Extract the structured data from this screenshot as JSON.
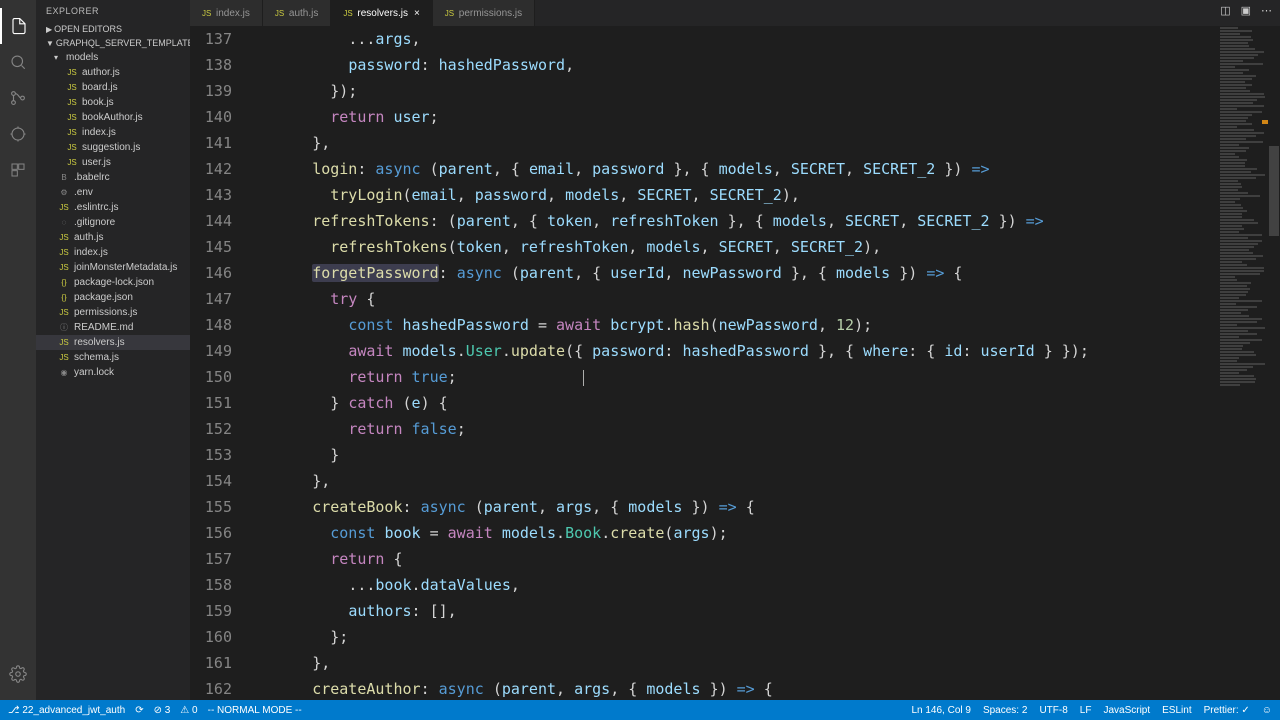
{
  "explorer": {
    "title": "EXPLORER"
  },
  "sections": {
    "openEditors": "OPEN EDITORS",
    "project": "GRAPHQL_SERVER_TEMPLATE"
  },
  "tree": {
    "folder_models": "models",
    "files_models": [
      "author.js",
      "board.js",
      "book.js",
      "bookAuthor.js",
      "index.js",
      "suggestion.js",
      "user.js"
    ],
    "files_root": [
      ".babelrc",
      ".env",
      ".eslintrc.js",
      ".gitignore",
      "auth.js",
      "index.js",
      "joinMonsterMetadata.js",
      "package-lock.json",
      "package.json",
      "permissions.js",
      "README.md",
      "resolvers.js",
      "schema.js",
      "yarn.lock"
    ]
  },
  "tabs": [
    {
      "label": "index.js",
      "active": false
    },
    {
      "label": "auth.js",
      "active": false
    },
    {
      "label": "resolvers.js",
      "active": true
    },
    {
      "label": "permissions.js",
      "active": false
    }
  ],
  "lineStart": 137,
  "lineCount": 26,
  "code": [
    {
      "i": 0,
      "h": "          <span class='tk-p'>...</span><span class='tk-v'>args</span><span class='tk-p'>,</span>"
    },
    {
      "i": 0,
      "h": "          <span class='tk-v'>password</span><span class='tk-p'>:</span> <span class='tk-v'>hashedPassword</span><span class='tk-p'>,</span>"
    },
    {
      "i": 0,
      "h": "        <span class='tk-p'>});</span>"
    },
    {
      "i": 0,
      "h": "        <span class='tk-k'>return</span> <span class='tk-v'>user</span><span class='tk-p'>;</span>"
    },
    {
      "i": 0,
      "h": "      <span class='tk-p'>},</span>"
    },
    {
      "i": 0,
      "h": "      <span class='tk-f'>login</span><span class='tk-p'>:</span> <span class='tk-b'>async</span> <span class='tk-p'>(</span><span class='tk-v'>parent</span><span class='tk-p'>, {</span> <span class='tk-v'>email</span><span class='tk-p'>,</span> <span class='tk-v'>password</span> <span class='tk-p'>}, {</span> <span class='tk-v'>models</span><span class='tk-p'>,</span> <span class='tk-v'>SECRET</span><span class='tk-p'>,</span> <span class='tk-v'>SECRET_2</span> <span class='tk-p'>})</span> <span class='tk-b'>=></span>"
    },
    {
      "i": 0,
      "h": "        <span class='tk-f'>tryLogin</span><span class='tk-p'>(</span><span class='tk-v'>email</span><span class='tk-p'>,</span> <span class='tk-v'>password</span><span class='tk-p'>,</span> <span class='tk-v'>models</span><span class='tk-p'>,</span> <span class='tk-v'>SECRET</span><span class='tk-p'>,</span> <span class='tk-v'>SECRET_2</span><span class='tk-p'>),</span>"
    },
    {
      "i": 0,
      "h": "      <span class='tk-f'>refreshTokens</span><span class='tk-p'>:</span> <span class='tk-p'>(</span><span class='tk-v'>parent</span><span class='tk-p'>, {</span> <span class='tk-v'>token</span><span class='tk-p'>,</span> <span class='tk-v'>refreshToken</span> <span class='tk-p'>}, {</span> <span class='tk-v'>models</span><span class='tk-p'>,</span> <span class='tk-v'>SECRET</span><span class='tk-p'>,</span> <span class='tk-v'>SECRET_2</span> <span class='tk-p'>})</span> <span class='tk-b'>=></span>"
    },
    {
      "i": 0,
      "h": "        <span class='tk-f'>refreshTokens</span><span class='tk-p'>(</span><span class='tk-v'>token</span><span class='tk-p'>,</span> <span class='tk-v'>refreshToken</span><span class='tk-p'>,</span> <span class='tk-v'>models</span><span class='tk-p'>,</span> <span class='tk-v'>SECRET</span><span class='tk-p'>,</span> <span class='tk-v'>SECRET_2</span><span class='tk-p'>),</span>"
    },
    {
      "i": 0,
      "h": "      <span class='word-hl'><span class='tk-f'>forgetPassword</span></span><span class='tk-p'>:</span> <span class='tk-b'>async</span> <span class='tk-p'>(</span><span class='tk-v'>parent</span><span class='tk-p'>, {</span> <span class='tk-v'>userId</span><span class='tk-p'>,</span> <span class='tk-v'>newPassword</span> <span class='tk-p'>}, {</span> <span class='tk-v'>models</span> <span class='tk-p'>})</span> <span class='tk-b'>=></span> <span class='tk-p'>{</span>"
    },
    {
      "i": 0,
      "h": "        <span class='tk-k'>try</span> <span class='tk-p'>{</span>"
    },
    {
      "i": 0,
      "h": "          <span class='tk-b'>const</span> <span class='tk-v'>hashedPassword</span> <span class='tk-p'>=</span> <span class='tk-k'>await</span> <span class='tk-v'>bcrypt</span><span class='tk-p'>.</span><span class='tk-f'>hash</span><span class='tk-p'>(</span><span class='tk-v'>newPassword</span><span class='tk-p'>,</span> <span class='tk-n'>12</span><span class='tk-p'>);</span>"
    },
    {
      "i": 0,
      "h": "          <span class='tk-k'>await</span> <span class='tk-v'>models</span><span class='tk-p'>.</span><span class='tk-t'>User</span><span class='tk-p'>.</span><span class='tk-f'>update</span><span class='tk-p'>({</span> <span class='tk-v'>password</span><span class='tk-p'>:</span> <span class='tk-v'>hashedPassword</span> <span class='tk-p'>}, {</span> <span class='tk-v'>where</span><span class='tk-p'>: {</span> <span class='tk-v'>id</span><span class='tk-p'>:</span> <span class='tk-v'>userId</span> <span class='tk-p'>} });</span>"
    },
    {
      "i": 0,
      "h": "          <span class='tk-k'>return</span> <span class='tk-b'>true</span><span class='tk-p'>;</span>              <span class='text-cursor'></span>"
    },
    {
      "i": 0,
      "h": "        <span class='tk-p'>}</span> <span class='tk-k'>catch</span> <span class='tk-p'>(</span><span class='tk-v'>e</span><span class='tk-p'>) {</span>"
    },
    {
      "i": 0,
      "h": "          <span class='tk-k'>return</span> <span class='tk-b'>false</span><span class='tk-p'>;</span>"
    },
    {
      "i": 0,
      "h": "        <span class='tk-p'>}</span>"
    },
    {
      "i": 0,
      "h": "      <span class='tk-p'>},</span>"
    },
    {
      "i": 0,
      "h": "      <span class='tk-f'>createBook</span><span class='tk-p'>:</span> <span class='tk-b'>async</span> <span class='tk-p'>(</span><span class='tk-v'>parent</span><span class='tk-p'>,</span> <span class='tk-v'>args</span><span class='tk-p'>, {</span> <span class='tk-v'>models</span> <span class='tk-p'>})</span> <span class='tk-b'>=></span> <span class='tk-p'>{</span>"
    },
    {
      "i": 0,
      "h": "        <span class='tk-b'>const</span> <span class='tk-v'>book</span> <span class='tk-p'>=</span> <span class='tk-k'>await</span> <span class='tk-v'>models</span><span class='tk-p'>.</span><span class='tk-t'>Book</span><span class='tk-p'>.</span><span class='tk-f'>create</span><span class='tk-p'>(</span><span class='tk-v'>args</span><span class='tk-p'>);</span>"
    },
    {
      "i": 0,
      "h": "        <span class='tk-k'>return</span> <span class='tk-p'>{</span>"
    },
    {
      "i": 0,
      "h": "          <span class='tk-p'>...</span><span class='tk-v'>book</span><span class='tk-p'>.</span><span class='tk-v'>dataValues</span><span class='tk-p'>,</span>"
    },
    {
      "i": 0,
      "h": "          <span class='tk-v'>authors</span><span class='tk-p'>:</span> <span class='tk-p'>[],</span>"
    },
    {
      "i": 0,
      "h": "        <span class='tk-p'>};</span>"
    },
    {
      "i": 0,
      "h": "      <span class='tk-p'>},</span>"
    },
    {
      "i": 0,
      "h": "      <span class='tk-f'>createAuthor</span><span class='tk-p'>:</span> <span class='tk-b'>async</span> <span class='tk-p'>(</span><span class='tk-v'>parent</span><span class='tk-p'>,</span> <span class='tk-v'>args</span><span class='tk-p'>, {</span> <span class='tk-v'>models</span> <span class='tk-p'>})</span> <span class='tk-b'>=></span> <span class='tk-p'>{</span>"
    }
  ],
  "status": {
    "branch": "22_advanced_jwt_auth",
    "sync": "⟳",
    "errors": "⊘ 3",
    "warnings": "⚠ 0",
    "mode": "-- NORMAL MODE --",
    "lncol": "Ln 146, Col 9",
    "spaces": "Spaces: 2",
    "encoding": "UTF-8",
    "eol": "LF",
    "lang": "JavaScript",
    "eslint": "ESLint",
    "prettier": "Prettier: ✓",
    "feedback": "☺"
  },
  "fileIcons": {
    "js": "JS",
    "json": "{}",
    "folder": "▸",
    "babelrc": "B",
    "env": "⚙",
    "gitignore": "◌",
    "md": "ⓘ",
    "lock": "🔒"
  }
}
